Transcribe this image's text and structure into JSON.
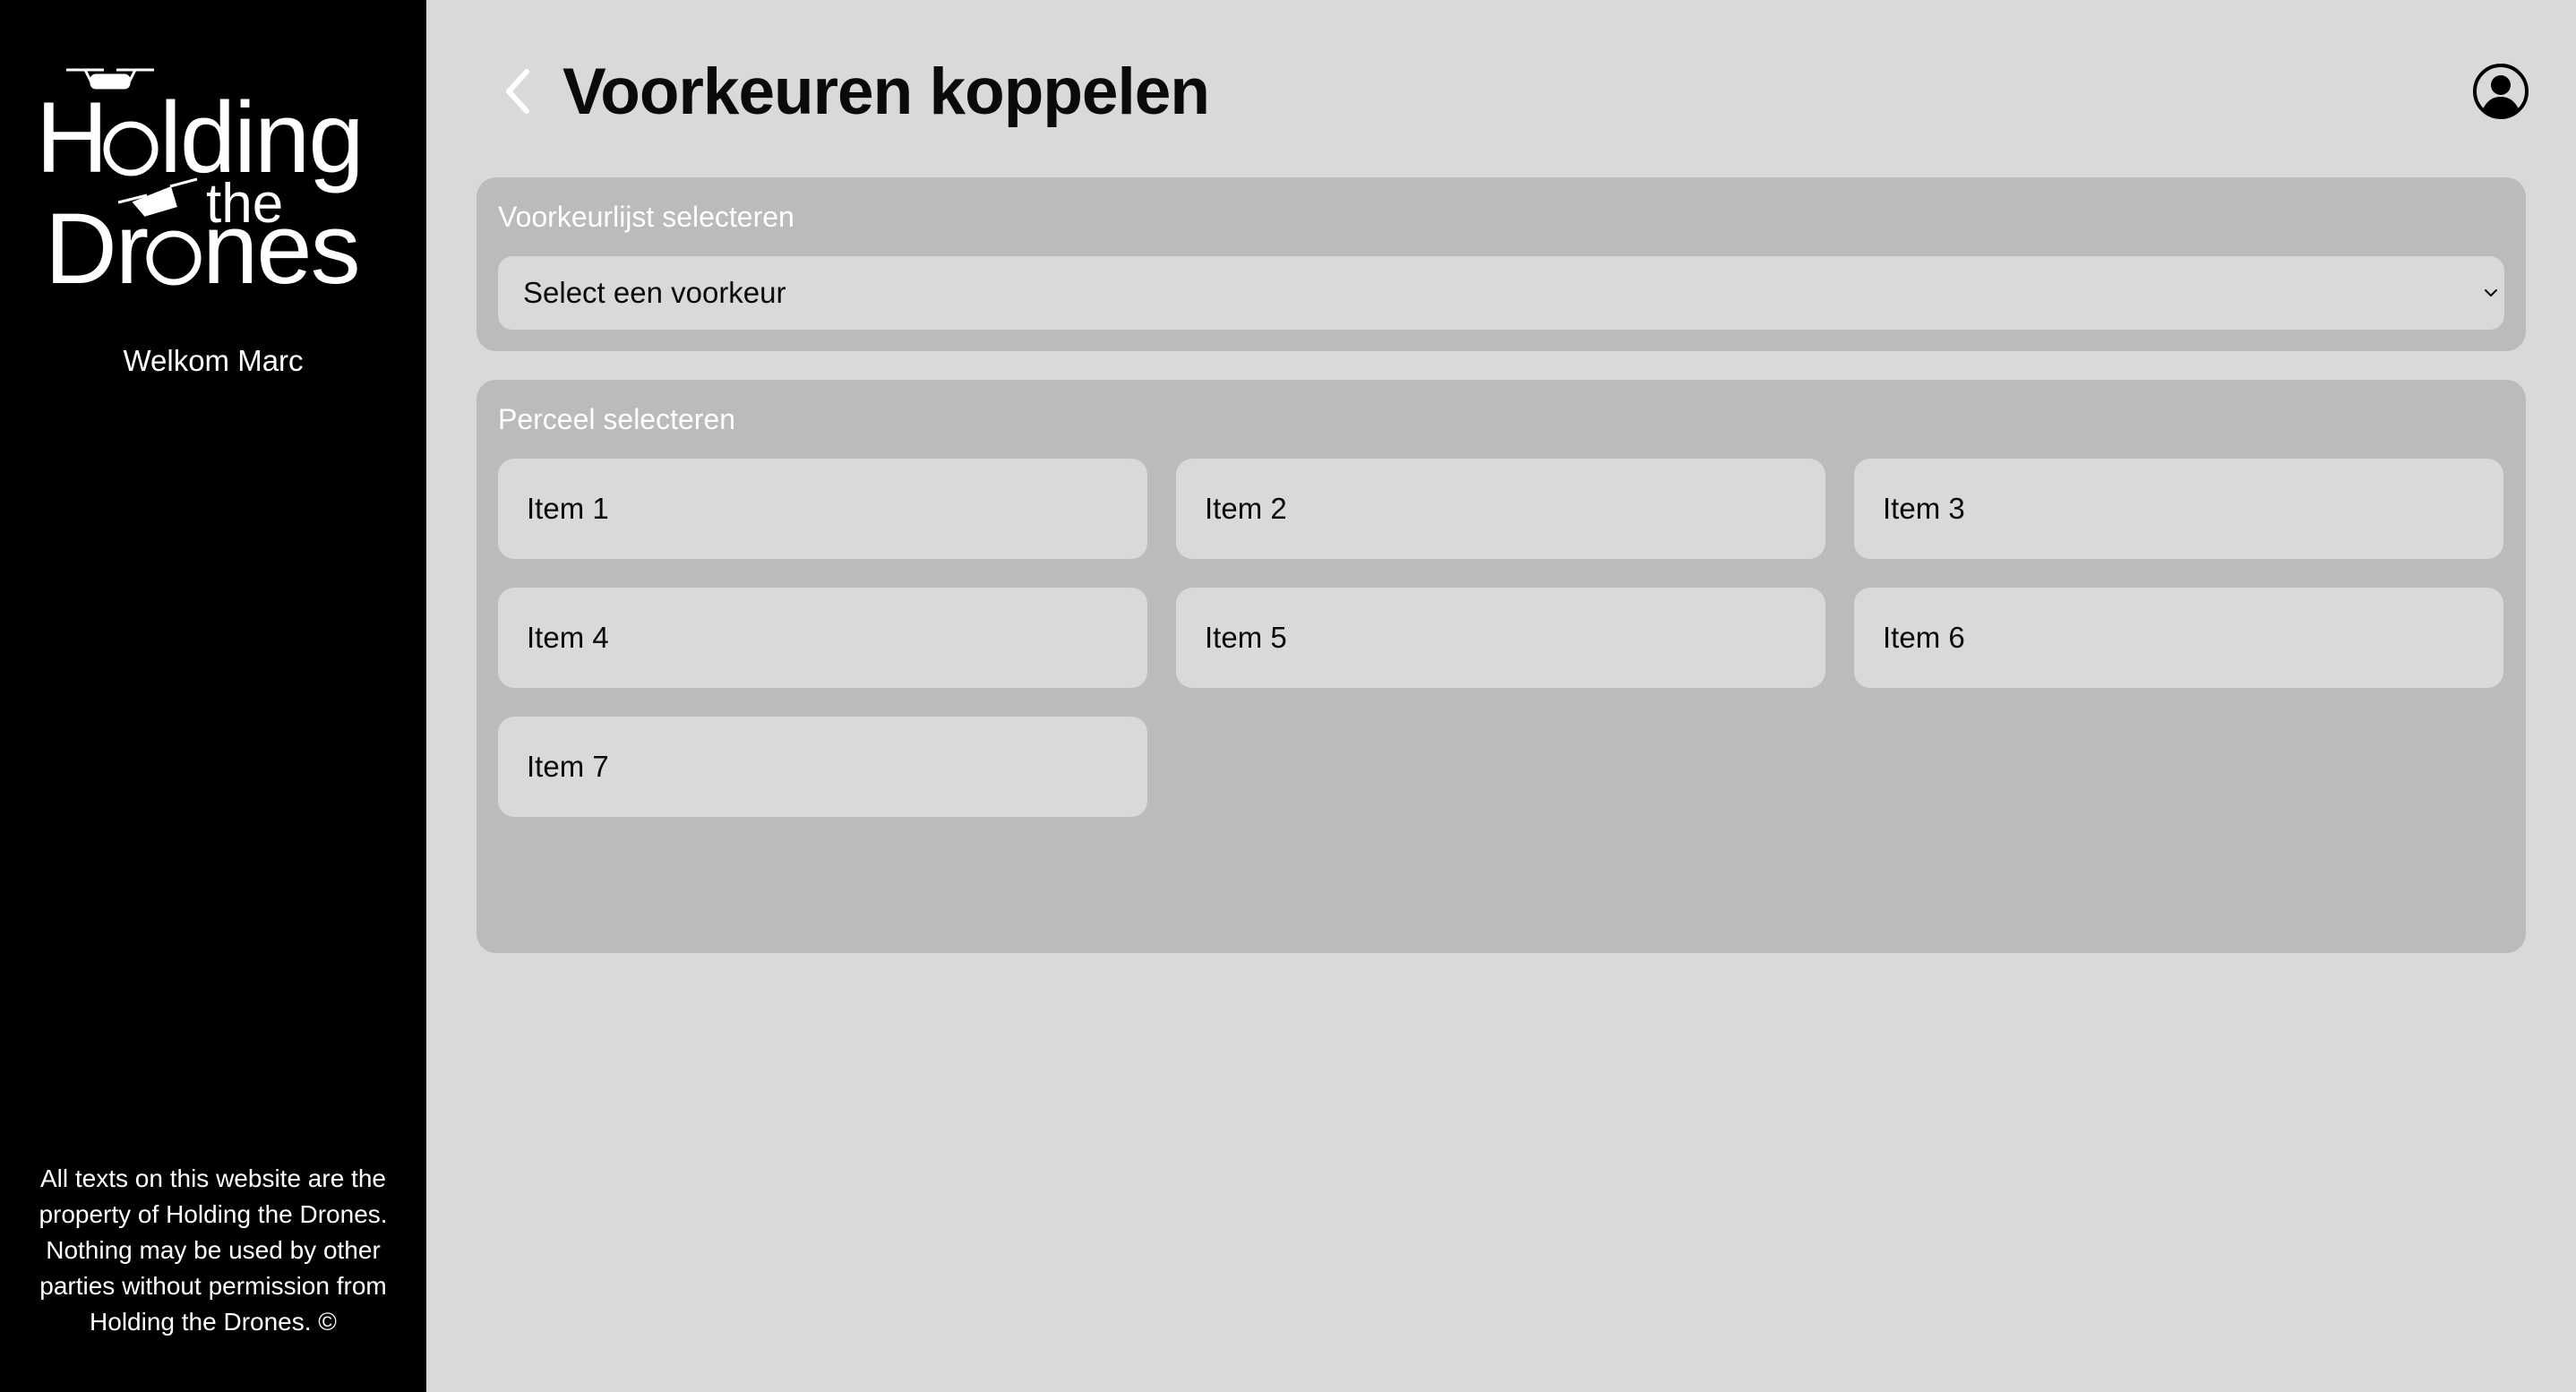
{
  "sidebar": {
    "logo_text": "Holding the Drones",
    "welcome": "Welkom Marc",
    "footer": "All texts on this website are the property of Holding the Drones. Nothing may be used by other parties without permission from Holding the Drones. ©"
  },
  "header": {
    "title": "Voorkeuren koppelen",
    "back_icon": "chevron-left-icon",
    "account_icon": "user-circle-icon"
  },
  "preference": {
    "label": "Voorkeurlijst selecteren",
    "select_value": "Select een voorkeur"
  },
  "plots": {
    "label": "Perceel selecteren",
    "items": [
      {
        "label": "Item 1"
      },
      {
        "label": "Item 2"
      },
      {
        "label": "Item 3"
      },
      {
        "label": "Item 4"
      },
      {
        "label": "Item 5"
      },
      {
        "label": "Item 6"
      },
      {
        "label": "Item 7"
      }
    ]
  },
  "colors": {
    "sidebar_bg": "#000000",
    "page_bg": "#d9d9d9",
    "panel_bg": "#bbbbbb",
    "text_dark": "#0a0a0a",
    "text_light": "#ffffff"
  }
}
